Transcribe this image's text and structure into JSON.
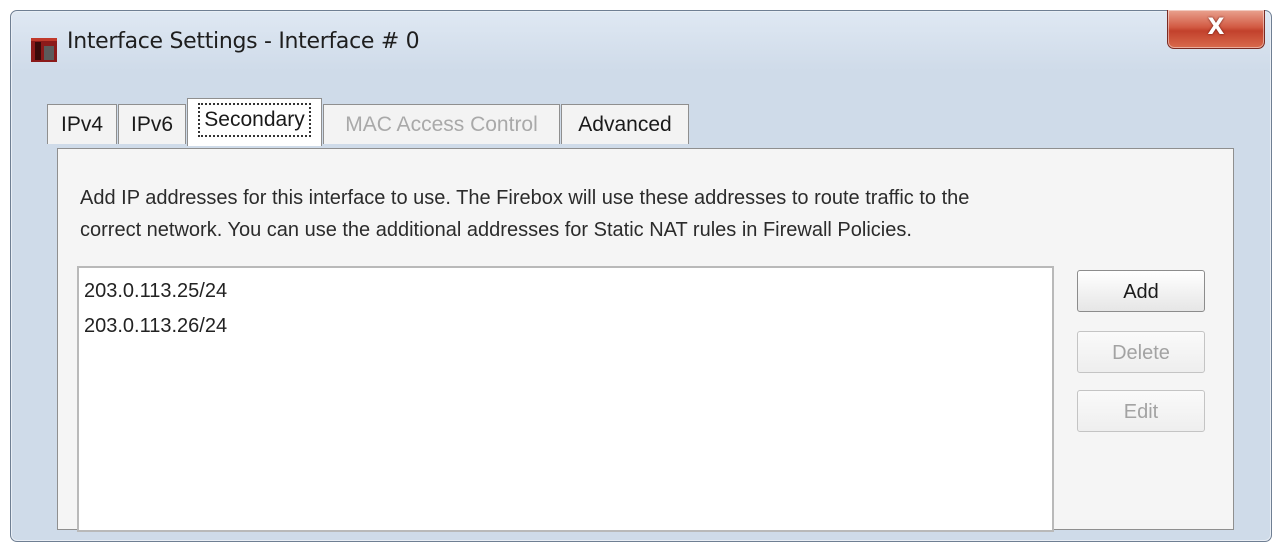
{
  "window": {
    "title": "Interface Settings - Interface # 0",
    "close_label": "X"
  },
  "tabs": [
    {
      "label": "IPv4",
      "state": "normal"
    },
    {
      "label": "IPv6",
      "state": "normal"
    },
    {
      "label": "Secondary",
      "state": "selected"
    },
    {
      "label": "MAC Access Control",
      "state": "disabled"
    },
    {
      "label": "Advanced",
      "state": "normal"
    }
  ],
  "secondary": {
    "description_line1": "Add IP addresses for this interface to use. The Firebox will use these addresses to route traffic to the",
    "description_line2": "correct network.  You can use the additional addresses for Static NAT rules in Firewall Policies.",
    "addresses": [
      "203.0.113.25/24",
      "203.0.113.26/24"
    ],
    "buttons": {
      "add": "Add",
      "delete": "Delete",
      "edit": "Edit"
    }
  },
  "colors": {
    "titlebar": "#cfdbe9",
    "close_button": "#c2412c",
    "app_icon": "#8b1a1a"
  }
}
